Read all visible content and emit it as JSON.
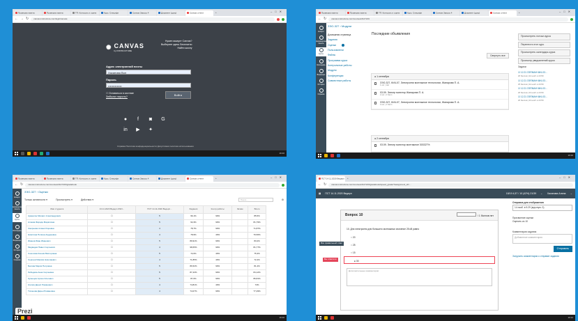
{
  "colors": {
    "desktop": "#1f8fd6",
    "canvas_nav": "#394b58",
    "link": "#0770a3",
    "login_bg": "#3c4148",
    "accent_red": "#e4455a"
  },
  "browser": {
    "tabs": [
      "Проверка пакета",
      "Проверка пакета",
      "ТП: Контроль и оценк",
      "Курс: Специфи",
      "Canvas Запрос 4",
      "Докуметн (доку)",
      "Canvas отчетн",
      "+"
    ],
    "tabs4": [
      "ПСТ 14.11.2020 Ведерп",
      "+"
    ]
  },
  "s1": {
    "url": "canvas.instructure.com/login/canvas",
    "logo": "CANVAS",
    "logo_sub": "by INSTRUCTURE",
    "links": [
      "Нужен аккаунт Canvas?",
      "Выберите здесь Бесплатно",
      "Найти школу"
    ],
    "email_label": "Адрес электронной почты",
    "email_value": "Хасанова Вол",
    "password_label": "Пароль",
    "password_value": "••••••••••••••",
    "remember_label": "Оставаться в системе",
    "forgot": "Забыли пароль?",
    "login_btn": "Войти",
    "footer": "Справка   Политика конфиденциальности   Допустимая политика использования",
    "time": "19:10",
    "date": "30.11.2020"
  },
  "s2": {
    "url": "canvas.instructure.com/courses/2127219",
    "crumb": "ЗЭО-327 › Модули",
    "subnav": [
      "Домашняя страница",
      "Задания",
      "Оценки",
      "Пользователи",
      "Файлы",
      "Программа курса",
      "Контрольные работы",
      "Модули",
      "Конференции",
      "Совместные работы"
    ],
    "nav": [
      "Аккаунт",
      "Информационная панель",
      "Курсы",
      "Календарь",
      "Входящие",
      "История",
      "Справка"
    ],
    "ann_title": "Последние объявления",
    "ann_btn": "Свернуть все",
    "modules": [
      {
        "title": "● 1 сентября",
        "items": [
          {
            "t": "ЗЭО-327, КИ4-07, Электрогем монтажное технологии, Жанарова П. А.",
            "s": "1 окт | Нет"
          },
          {
            "t": "03.09. Электр монитор Жанарова П. А.",
            "s": "2 окт | 1 балл"
          },
          {
            "t": "ЗЭО-327, КИ4-07, Электрогем монтажное технологии, Жанарова П. А.",
            "s": "3 окт | 1 балл"
          }
        ]
      },
      {
        "title": "● 2 сентября",
        "items": [
          {
            "t": "03.09. Электр монитор монтажное 303327%",
            "s": ""
          }
        ]
      }
    ],
    "right_btns": [
      "Просмотреть потоки курса",
      "Перенести этот курс",
      "Просмотреть календарь курса",
      "Просмотр уведомлений курса"
    ],
    "todo_title": "Задачи",
    "todo": [
      {
        "t": "12.21 ЗЭПМАН КИ4-03...",
        "s": "20 баллов | 22 нояб. в 23:59"
      },
      {
        "t": "12.21 ЗЭПМАН КИ4-03...",
        "s": "25 баллов | 22 нояб. в 23:59"
      },
      {
        "t": "12.21 ЗЭПМАН КИ4-03...",
        "s": "20 баллов | 23 нояб. в 23:59"
      },
      {
        "t": "12.21 ЗЭПМАН КИ4-03...",
        "s": "20 баллов | 23 нояб. в 23:59"
      }
    ],
    "time": "19:10"
  },
  "s3": {
    "url": "canvas.instructure.com/courses/2127219/gradebook",
    "crumb": "ЗЭО-327 › Оценки",
    "tools": [
      "Только активности ▾",
      "Просмотреть ▾",
      "Действия ▾"
    ],
    "search_placeholder": "Поиск...",
    "headers": [
      "Имя студента",
      "13.11.2020 Ведерп ЗЭО...",
      "ПСТ 14.11.2020 Ведерп...",
      "Задания",
      "Контр.работы",
      "Экзам",
      "Всего"
    ],
    "rows": [
      [
        "Аракелян Михаил Александрович",
        "",
        "5",
        "96,1%",
        "90%",
        "",
        "85,5%"
      ],
      [
        "Алиева Фарида Маратовна",
        "",
        "5",
        "94,3%",
        "90%",
        "",
        "81,79%"
      ],
      [
        "Смирнова Алина Игоревна",
        "",
        "4",
        "78,7%",
        "90%",
        "",
        "71,87%"
      ],
      [
        "Никитина Полина Андреевна",
        "",
        "4",
        "78,9%",
        "40%",
        "",
        "79,56%"
      ],
      [
        "Иванов Иван Иванович",
        "",
        "5",
        "89,91%",
        "90%",
        "",
        "83,2%"
      ],
      [
        "Медведев Павел Сергеевич",
        "",
        "4",
        "98,65%",
        "90%",
        "",
        "81,77%"
      ],
      [
        "Соколова Ксения Викторовна",
        "",
        "5",
        "72,0%",
        "40%",
        "",
        "75,3%"
      ],
      [
        "Сергеев Максим Николаевич",
        "",
        "4",
        "71,85%",
        "40%",
        "",
        "72,4%"
      ],
      [
        "Белова Мария Петровна",
        "",
        "5",
        "86,52%",
        "90%",
        "",
        "81,4%"
      ],
      [
        "Лебедева Анна Сергеевна",
        "",
        "5",
        "87,43%",
        "90%",
        "",
        "84,12%"
      ],
      [
        "Кузнецов Артем Олегович",
        "",
        "5",
        "87,6%",
        "90%",
        "",
        "86,81%"
      ],
      [
        "Козлов Денис Романович",
        "",
        "4",
        "74,81%",
        "40%",
        "",
        "74%"
      ],
      [
        "Тихонова Дарья Романовна",
        "",
        "4",
        "74,07%",
        "90%",
        "",
        "77,29%"
      ]
    ],
    "prezi": "Prezi",
    "time": "19:10"
  },
  "s4": {
    "url": "canvas.instructure.com/courses/2127219/gradebook/speed_grader?assignment_id=...",
    "title": "ПСТ 14.11.2020 Ведерп",
    "stats": [
      "18/19  4,57 / 10 (42%)  21/39"
    ],
    "student": "Хасанова Алина",
    "question": "Вопрос 10",
    "points": "/ 1 баллов нет",
    "q_text": "10. Для электрогем для большего монтажных значение 25 кВ равно",
    "answers": [
      "20",
      "25",
      "15",
      "30"
    ],
    "lab_correct": "Все правильный ответ",
    "lab_you": "Вы ответили",
    "comment_placeholder": "Дополнительные комментарии:",
    "right_title": "Отправка для отображения",
    "right_sel": "14 нояб. в 9:29 (вручную: 3)",
    "score_label": "Присвоение оценки",
    "score_val": "Оценить из 10",
    "comment_label": "Комментарии задания",
    "comment_ph": "Добавление комментария",
    "send_btn": "Отправить",
    "footer_link": "Загрузить комментарии к отправке задания",
    "time": "19:12"
  }
}
